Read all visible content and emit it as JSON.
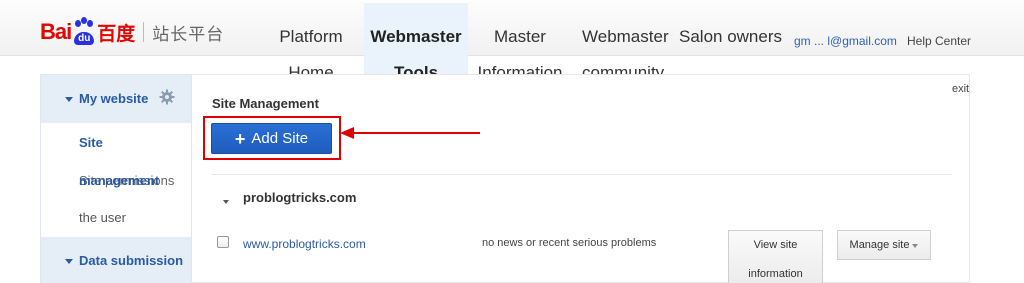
{
  "logo": {
    "brand_left": "Bai",
    "brand_paw": "du",
    "brand_cn": "百度",
    "product": "站长平台"
  },
  "nav": [
    {
      "line1": "Platform",
      "line2": "Home"
    },
    {
      "line1": "Webmaster",
      "line2": "Tools",
      "active": true
    },
    {
      "line1": "Master",
      "line2": "Information"
    },
    {
      "line1": "Webmaster",
      "line2": "community"
    },
    {
      "line1": "Salon owners",
      "line2": ""
    }
  ],
  "header": {
    "user": "gm ... l@gmail.com",
    "help": "Help Center"
  },
  "sidebar": {
    "section1": "My website",
    "items": [
      {
        "label": "Site"
      },
      {
        "label_over": "management",
        "label_under": "Site permissions"
      },
      {
        "label": "the user"
      }
    ],
    "section2": "Data submission"
  },
  "main": {
    "title": "Site Management",
    "exit": "exit",
    "add_site": "Add Site",
    "add_site_icon": "plus-icon",
    "site_group": "problogtricks.com",
    "site": {
      "url": "www.problogtricks.com",
      "status": "no news or recent serious problems",
      "view_line1": "View site",
      "view_line2": "information",
      "manage": "Manage site"
    }
  },
  "colors": {
    "brand_red": "#e10602",
    "brand_blue": "#2932e1",
    "button_blue": "#1f5cbd",
    "link_blue": "#2a5aa5",
    "annotation_red": "#e00000"
  }
}
